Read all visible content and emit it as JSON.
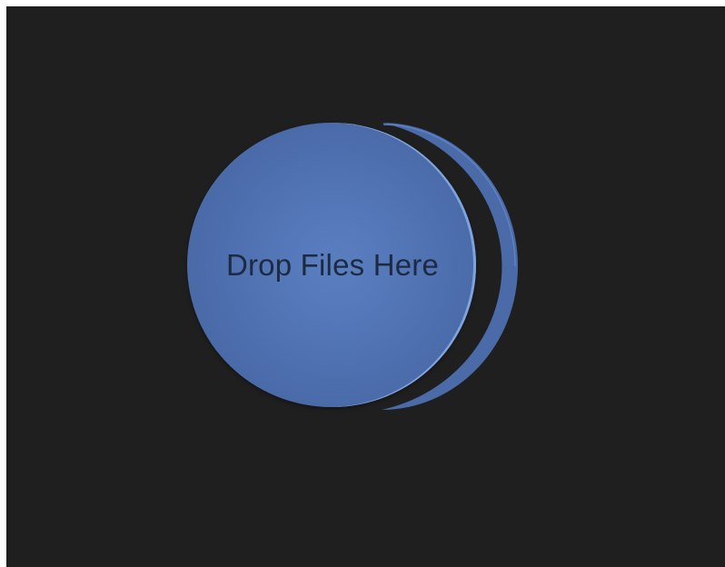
{
  "drop_zone": {
    "label": "Drop Files Here",
    "colors": {
      "background": "#1f1f1f",
      "disc": "#4e6fae",
      "disc_highlight": "#7fa4dd",
      "label_text": "#1e2a40"
    }
  }
}
